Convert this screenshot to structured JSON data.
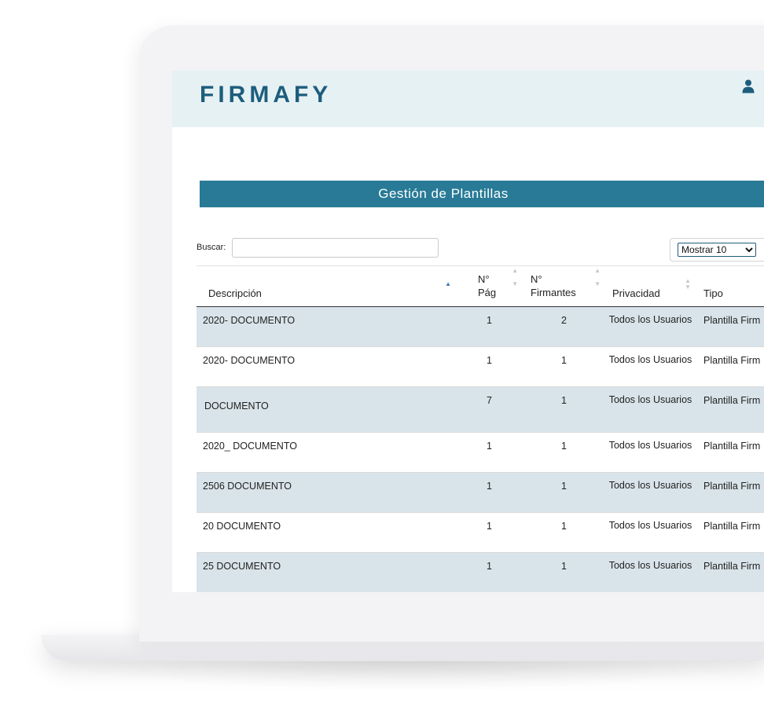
{
  "header": {
    "brand": "FIRMAFY",
    "user_icon": "user-icon"
  },
  "page": {
    "title": "Gestión de Plantillas"
  },
  "search": {
    "label": "Buscar:",
    "value": "",
    "placeholder": ""
  },
  "page_size": {
    "selected": "Mostrar 10"
  },
  "table": {
    "columns": [
      {
        "key": "descripcion",
        "label": "Descripción",
        "sort": "asc"
      },
      {
        "key": "pag",
        "label": "N° Pág",
        "sort": "none"
      },
      {
        "key": "firmantes",
        "label": "N° Firmantes",
        "sort": "none"
      },
      {
        "key": "privacidad",
        "label": "Privacidad",
        "sort": "none"
      },
      {
        "key": "tipo",
        "label": "Tipo",
        "sort": "none"
      }
    ],
    "rows": [
      {
        "descripcion": "2020- DOCUMENTO",
        "pag": "1",
        "firmantes": "2",
        "privacidad": "Todos los Usuarios",
        "tipo": "Plantilla Firm"
      },
      {
        "descripcion": "2020- DOCUMENTO",
        "pag": "1",
        "firmantes": "1",
        "privacidad": "Todos los Usuarios",
        "tipo": "Plantilla Firm"
      },
      {
        "descripcion": "DOCUMENTO",
        "pag": "7",
        "firmantes": "1",
        "privacidad": "Todos los Usuarios",
        "tipo": "Plantilla Firm"
      },
      {
        "descripcion": "2020_ DOCUMENTO",
        "pag": "1",
        "firmantes": "1",
        "privacidad": "Todos los Usuarios",
        "tipo": "Plantilla Firm"
      },
      {
        "descripcion": "2506 DOCUMENTO",
        "pag": "1",
        "firmantes": "1",
        "privacidad": "Todos los Usuarios",
        "tipo": "Plantilla Firm"
      },
      {
        "descripcion": "20 DOCUMENTO",
        "pag": "1",
        "firmantes": "1",
        "privacidad": "Todos los Usuarios",
        "tipo": "Plantilla Firm"
      },
      {
        "descripcion": "25 DOCUMENTO",
        "pag": "1",
        "firmantes": "1",
        "privacidad": "Todos los Usuarios",
        "tipo": "Plantilla Firm"
      }
    ]
  },
  "colors": {
    "brand": "#1d5d7c",
    "header_bg": "#e6f1f4",
    "title_bar": "#287a96",
    "row_shaded": "#d9e4ea",
    "sort_active": "#3a79b8"
  }
}
